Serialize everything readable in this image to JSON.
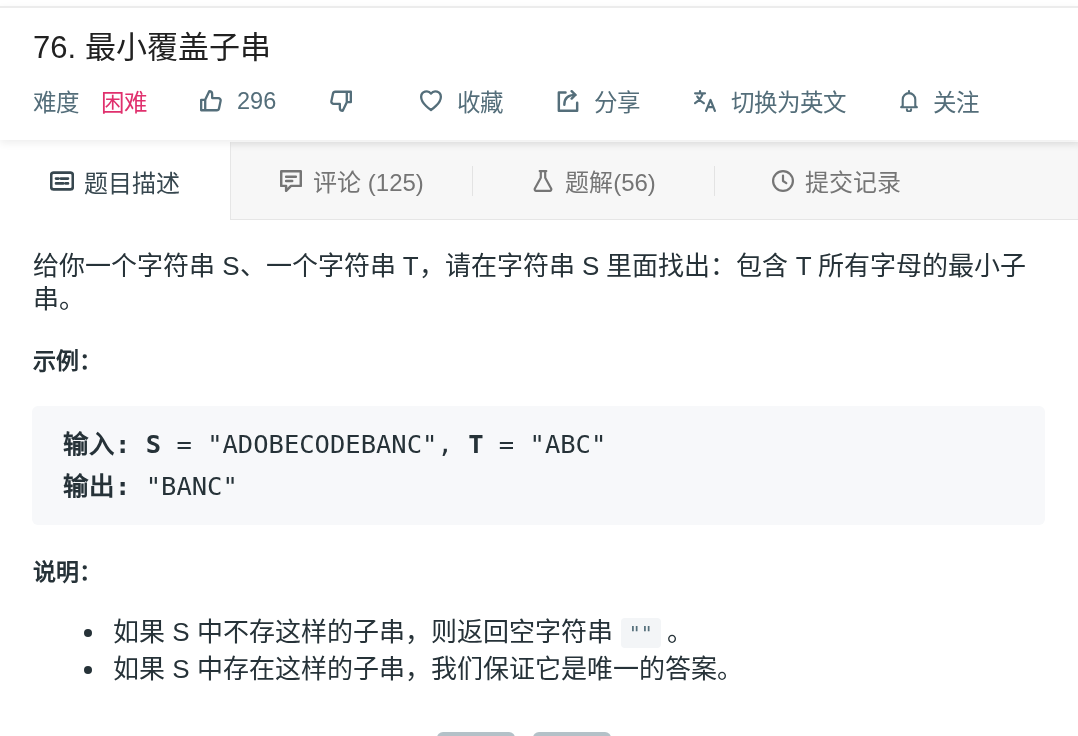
{
  "problem": {
    "title": "76. 最小覆盖子串",
    "meta": {
      "difficulty_label": "难度",
      "difficulty": "困难",
      "actions": [
        {
          "kind": "like",
          "label": "296"
        },
        {
          "kind": "dislike"
        },
        {
          "kind": "favorite",
          "label": "收藏"
        },
        {
          "kind": "share",
          "label": "分享"
        },
        {
          "kind": "translate",
          "label": "切换为英文"
        },
        {
          "kind": "follow",
          "label": "关注"
        }
      ]
    }
  },
  "tabs": [
    {
      "kind": "description",
      "label": "题目描述",
      "selected": true
    },
    {
      "kind": "comments",
      "label": "评论 (125)",
      "selected": false
    },
    {
      "kind": "solutions",
      "label": "题解(56)",
      "selected": false
    },
    {
      "kind": "submissions",
      "label": "提交记录",
      "selected": false
    }
  ],
  "content": {
    "description": "给你一个字符串 S、一个字符串 T，请在字符串 S 里面找出：包含 T 所有字母的最小子串。",
    "example_heading": "示例：",
    "example_lines": [
      "**输入:** **S** = \"ADOBECODEBANC\", **T** = \"ABC\"",
      "**输出:** \"BANC\""
    ],
    "notes_heading": "说明：",
    "notes": [
      {
        "text": "如果 S 中不存这样的子串，则返回空字符串",
        "code": "\"\"",
        "after": "。"
      },
      {
        "text": "如果 S 中存在这样的子串，我们保证它是唯一的答案。"
      }
    ]
  }
}
